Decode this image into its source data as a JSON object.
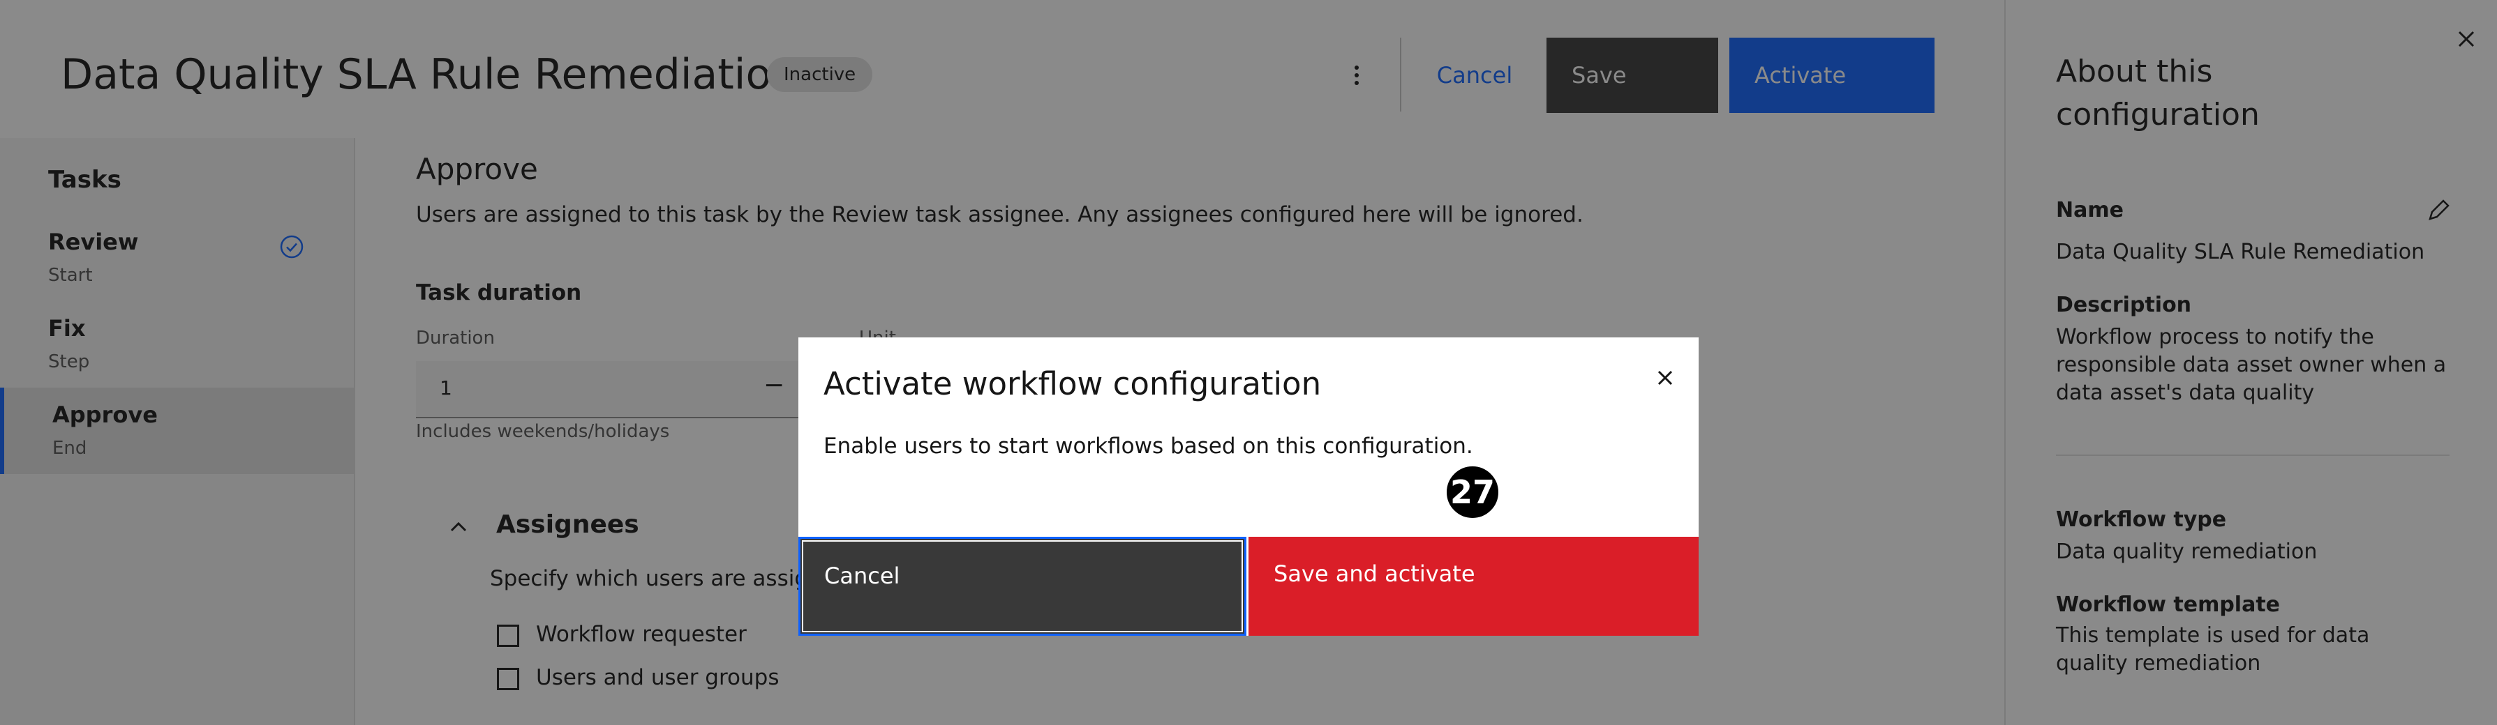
{
  "header": {
    "title": "Data Quality SLA Rule Remediation",
    "status": "Inactive",
    "cancel_label": "Cancel",
    "save_label": "Save",
    "activate_label": "Activate"
  },
  "sidebar": {
    "heading": "Tasks",
    "items": [
      {
        "label": "Review",
        "sub": "Start",
        "done": true
      },
      {
        "label": "Fix",
        "sub": "Step"
      },
      {
        "label": "Approve",
        "sub": "End",
        "active": true
      }
    ]
  },
  "main": {
    "section_title": "Approve",
    "section_desc": "Users are assigned to this task by the Review task assignee. Any assignees configured here will be ignored.",
    "duration_heading": "Task duration",
    "duration_label": "Duration",
    "duration_value": "1",
    "unit_label": "Unit",
    "helper": "Includes weekends/holidays",
    "assignees_title": "Assignees",
    "assignees_desc": "Specify which users are assigned",
    "checkboxes": [
      "Workflow requester",
      "Users and user groups"
    ]
  },
  "right_panel": {
    "title": "About this configuration",
    "name_label": "Name",
    "name_value": "Data Quality SLA Rule Remediation",
    "description_label": "Description",
    "description_value": "Workflow process to notify the responsible data asset owner when a data asset's data quality assessment...",
    "type_label": "Workflow type",
    "type_value": "Data quality remediation",
    "template_label": "Workflow template",
    "template_value": "This template is used for data quality remediation"
  },
  "modal": {
    "title": "Activate workflow configuration",
    "body": "Enable users to start workflows based on this configuration.",
    "cancel_label": "Cancel",
    "confirm_label": "Save and activate"
  },
  "annotation": {
    "step": "27"
  },
  "colors": {
    "primary": "#0f62fe",
    "danger": "#da1e28",
    "secondary": "#393939"
  }
}
